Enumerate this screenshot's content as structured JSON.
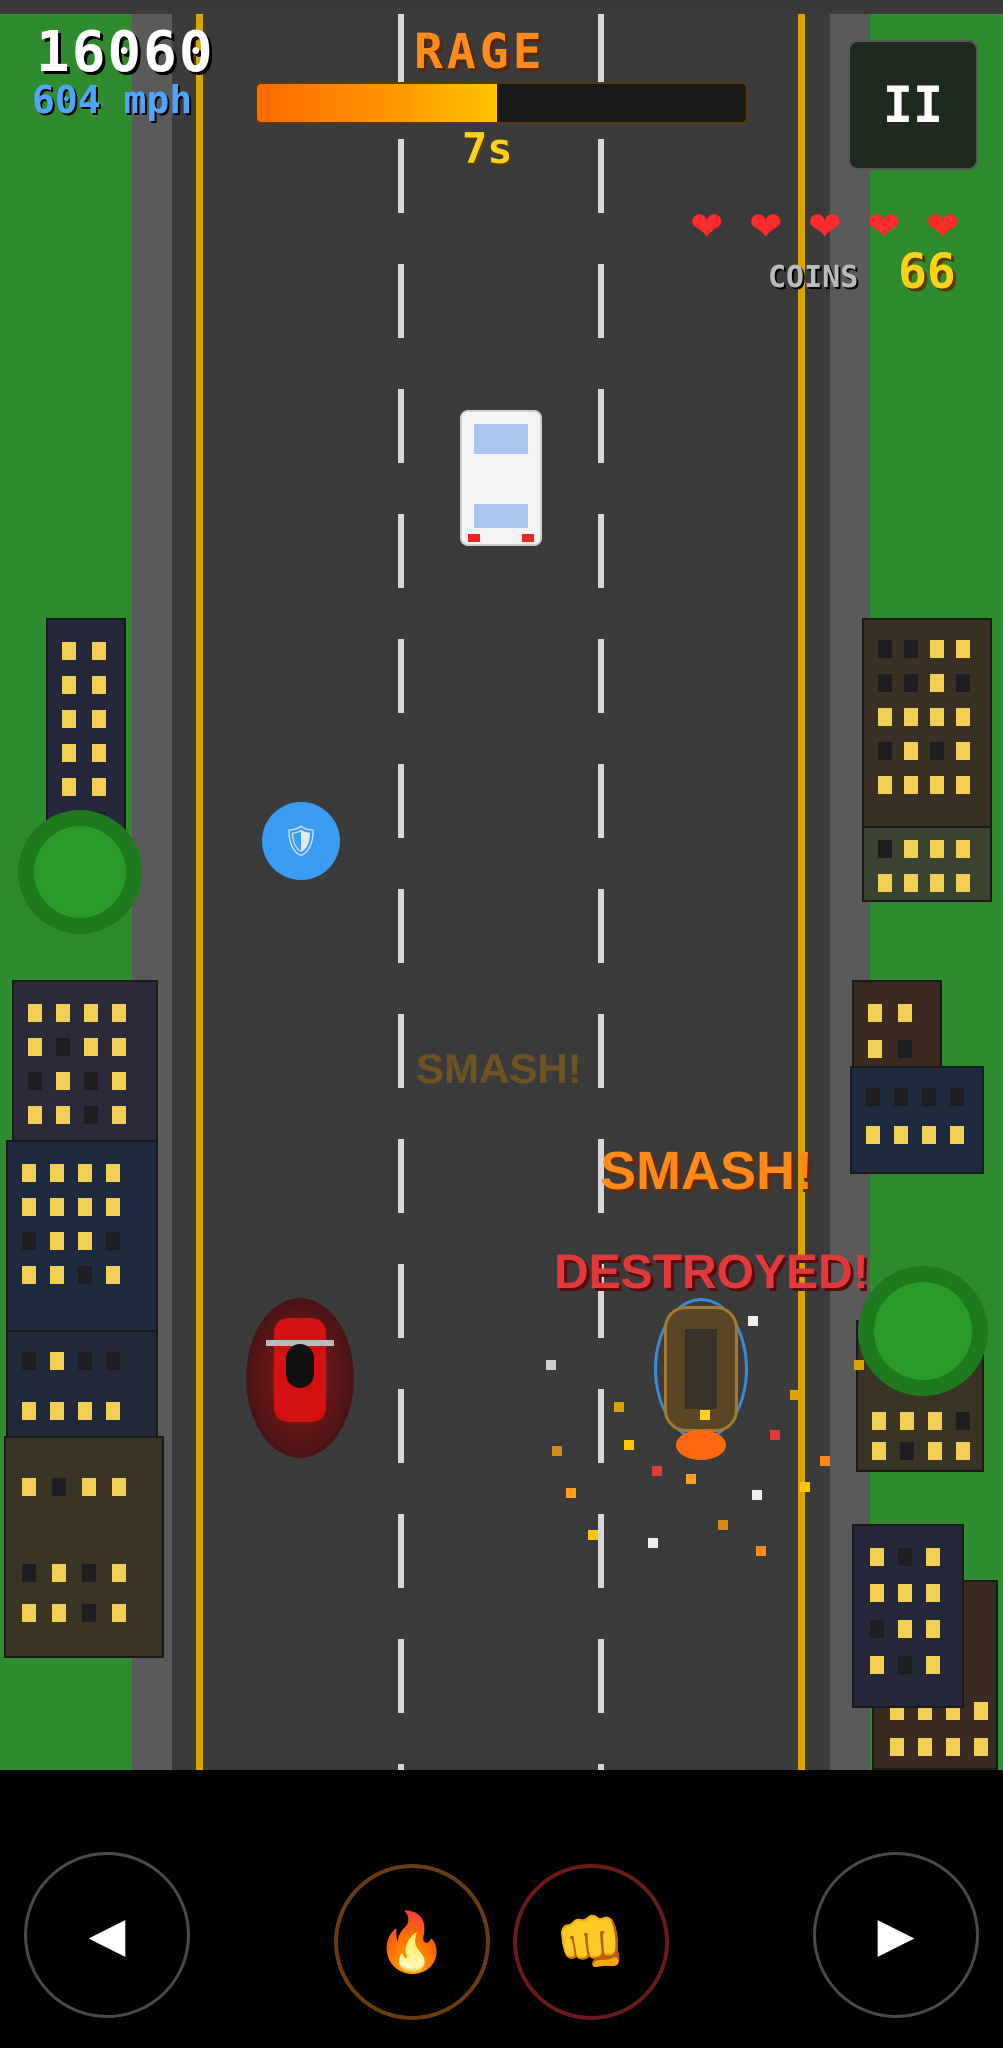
{
  "hud": {
    "score": "16060",
    "speed": "604 mph",
    "rage_label": "RAGE",
    "rage_fraction": 0.49,
    "rage_timer": "7s",
    "pause_label": "II",
    "lives": 5,
    "coins_label": "COINS",
    "coins_value": "66"
  },
  "popups": {
    "smash_faint": "SMASH!",
    "smash": "SMASH!",
    "destroyed": "DESTROYED!"
  },
  "controls": {
    "left_icon": "◀",
    "right_icon": "▶",
    "fire_icon": "🔥",
    "punch_icon": "👊"
  },
  "icons": {
    "heart": "❤",
    "shield": "🛡"
  },
  "colors": {
    "rage_accent": "#ff8c1a",
    "speed_blue": "#4fa6ff",
    "coins_yellow": "#ffd21a",
    "heart_red": "#ff2a2a"
  }
}
